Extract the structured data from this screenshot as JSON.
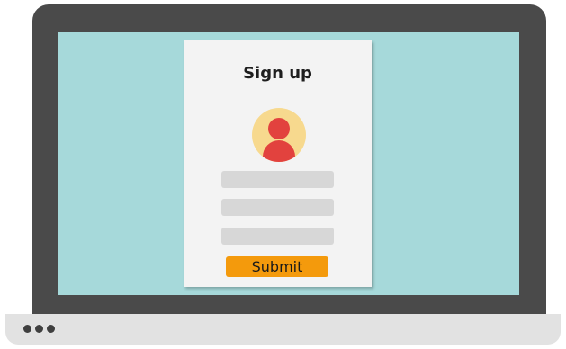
{
  "signup": {
    "title": "Sign up",
    "fields": [
      {
        "name": "field-1",
        "value": "",
        "placeholder": ""
      },
      {
        "name": "field-2",
        "value": "",
        "placeholder": ""
      },
      {
        "name": "field-3",
        "value": "",
        "placeholder": ""
      }
    ],
    "submit_label": "Submit"
  },
  "icons": {
    "avatar": "user-avatar-icon",
    "window_dots": "three-dots-icon"
  },
  "colors": {
    "laptop_frame": "#4a4a4a",
    "screen_background": "#a6d9da",
    "card_background": "#f3f3f3",
    "avatar_background": "#f7d98e",
    "avatar_figure": "#e2423e",
    "field_background": "#d7d7d7",
    "submit_button": "#f49a0c",
    "laptop_base": "#e2e2e2"
  }
}
